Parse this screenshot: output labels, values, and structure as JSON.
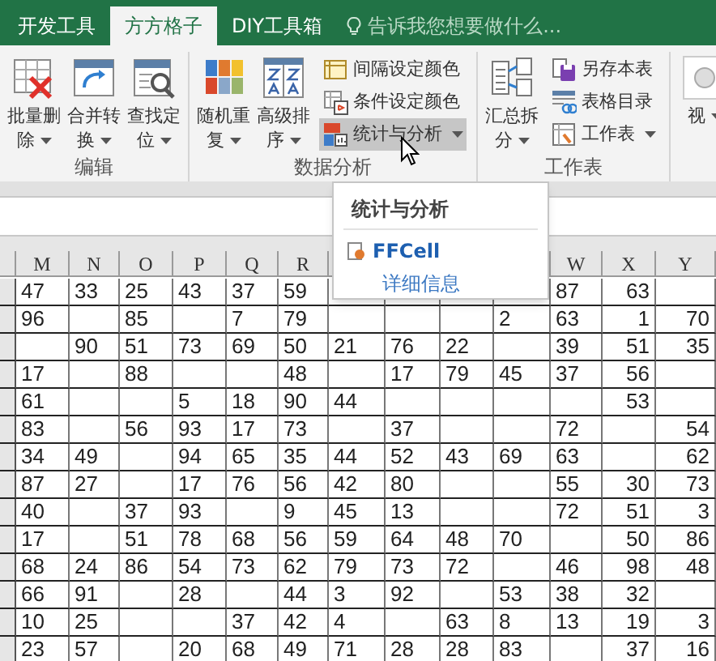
{
  "tabs": [
    {
      "label": "开发工具",
      "selected": false
    },
    {
      "label": "方方格子",
      "selected": true
    },
    {
      "label": "DIY工具箱",
      "selected": false
    }
  ],
  "tell_me": {
    "placeholder": "告诉我您想要做什么..."
  },
  "ribbon_groups": [
    {
      "label": "编辑",
      "items": [
        {
          "kind": "large",
          "label": "批量删除",
          "dropdown": true
        },
        {
          "kind": "large",
          "label": "合并转换",
          "dropdown": true
        },
        {
          "kind": "large",
          "label": "查找定位",
          "dropdown": true
        }
      ]
    },
    {
      "label": "数据分析",
      "items": [
        {
          "kind": "large",
          "label": "随机重复",
          "dropdown": true
        },
        {
          "kind": "large",
          "label": "高级排序",
          "dropdown": true
        },
        {
          "kind": "small_stack",
          "buttons": [
            {
              "label": "间隔设定颜色",
              "dropdown": false,
              "highlighted": false
            },
            {
              "label": "条件设定颜色",
              "dropdown": false,
              "highlighted": false
            },
            {
              "label": "统计与分析",
              "dropdown": true,
              "highlighted": true
            }
          ]
        }
      ]
    },
    {
      "label": "工作表",
      "items": [
        {
          "kind": "large",
          "label": "汇总拆分",
          "dropdown": true
        },
        {
          "kind": "small_stack",
          "buttons": [
            {
              "label": "另存本表",
              "dropdown": false,
              "highlighted": false
            },
            {
              "label": "表格目录",
              "dropdown": false,
              "highlighted": false
            },
            {
              "label": "工作表",
              "dropdown": true,
              "highlighted": false
            }
          ]
        }
      ]
    },
    {
      "items": [
        {
          "kind": "large",
          "label": "视",
          "dropdown": true
        }
      ]
    }
  ],
  "popup_menu": {
    "title": "统计与分析",
    "item": "FFCell",
    "link": "详细信息"
  },
  "sheet": {
    "columns": [
      "M",
      "N",
      "O",
      "P",
      "Q",
      "R",
      null,
      null,
      null,
      null,
      "W",
      "X",
      "Y"
    ],
    "rows": [
      [
        "47",
        "33",
        "25",
        "43",
        "37",
        "59",
        null,
        null,
        null,
        null,
        "87",
        "63",
        null
      ],
      [
        "96",
        null,
        "85",
        null,
        "7",
        "79",
        null,
        null,
        null,
        "2",
        "63",
        "1",
        "70"
      ],
      [
        null,
        "90",
        "51",
        "73",
        "69",
        "50",
        "21",
        "76",
        "22",
        null,
        "39",
        "51",
        "35"
      ],
      [
        "17",
        null,
        "88",
        null,
        null,
        "48",
        null,
        "17",
        "79",
        "45",
        "37",
        "56",
        null
      ],
      [
        "61",
        null,
        null,
        "5",
        "18",
        "90",
        "44",
        null,
        null,
        null,
        null,
        "53",
        null
      ],
      [
        "83",
        null,
        "56",
        "93",
        "17",
        "73",
        null,
        "37",
        null,
        null,
        "72",
        null,
        "54"
      ],
      [
        "34",
        "49",
        null,
        "94",
        "65",
        "35",
        "44",
        "52",
        "43",
        "69",
        "63",
        null,
        "62"
      ],
      [
        "87",
        "27",
        null,
        "17",
        "76",
        "56",
        "42",
        "80",
        null,
        null,
        "55",
        "30",
        "73"
      ],
      [
        "40",
        null,
        "37",
        "93",
        null,
        "9",
        "45",
        "13",
        null,
        null,
        "72",
        "51",
        "3"
      ],
      [
        "17",
        null,
        "51",
        "78",
        "68",
        "56",
        "59",
        "64",
        "48",
        "70",
        null,
        "50",
        "86"
      ],
      [
        "68",
        "24",
        "86",
        "54",
        "73",
        "62",
        "79",
        "73",
        "72",
        null,
        "46",
        "98",
        "48"
      ],
      [
        "66",
        "91",
        null,
        "28",
        null,
        "44",
        "3",
        "92",
        null,
        "53",
        "38",
        "32",
        null
      ],
      [
        "10",
        "25",
        null,
        null,
        "37",
        "42",
        "4",
        null,
        "63",
        "8",
        "13",
        "19",
        "3"
      ],
      [
        "23",
        "57",
        null,
        "20",
        "68",
        "49",
        "71",
        "28",
        "28",
        "83",
        null,
        "37",
        "16"
      ]
    ]
  }
}
